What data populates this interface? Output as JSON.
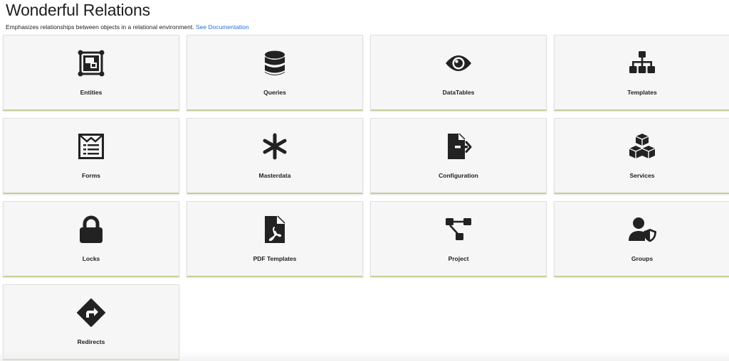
{
  "page": {
    "title": "Wonderful Relations",
    "description": "Emphasizes relationships between objects in a relational environment.",
    "doc_link": "See Documentation"
  },
  "colors": {
    "icon": "#222222",
    "tile_background": "#f6f6f6",
    "tile_bottom_border": "#c4cf9b",
    "link": "#2a6fd6"
  },
  "tiles": [
    {
      "label": "Entities",
      "icon": "entities-icon"
    },
    {
      "label": "Queries",
      "icon": "database-icon"
    },
    {
      "label": "DataTables",
      "icon": "eye-icon"
    },
    {
      "label": "Templates",
      "icon": "sitemap-icon"
    },
    {
      "label": "Forms",
      "icon": "form-icon"
    },
    {
      "label": "Masterdata",
      "icon": "asterisk-icon"
    },
    {
      "label": "Configuration",
      "icon": "file-export-icon"
    },
    {
      "label": "Services",
      "icon": "cubes-icon"
    },
    {
      "label": "Locks",
      "icon": "lock-icon"
    },
    {
      "label": "PDF Templates",
      "icon": "file-pdf-icon"
    },
    {
      "label": "Project",
      "icon": "diagram-project-icon"
    },
    {
      "label": "Groups",
      "icon": "user-shield-icon"
    },
    {
      "label": "Redirects",
      "icon": "directions-icon"
    }
  ]
}
